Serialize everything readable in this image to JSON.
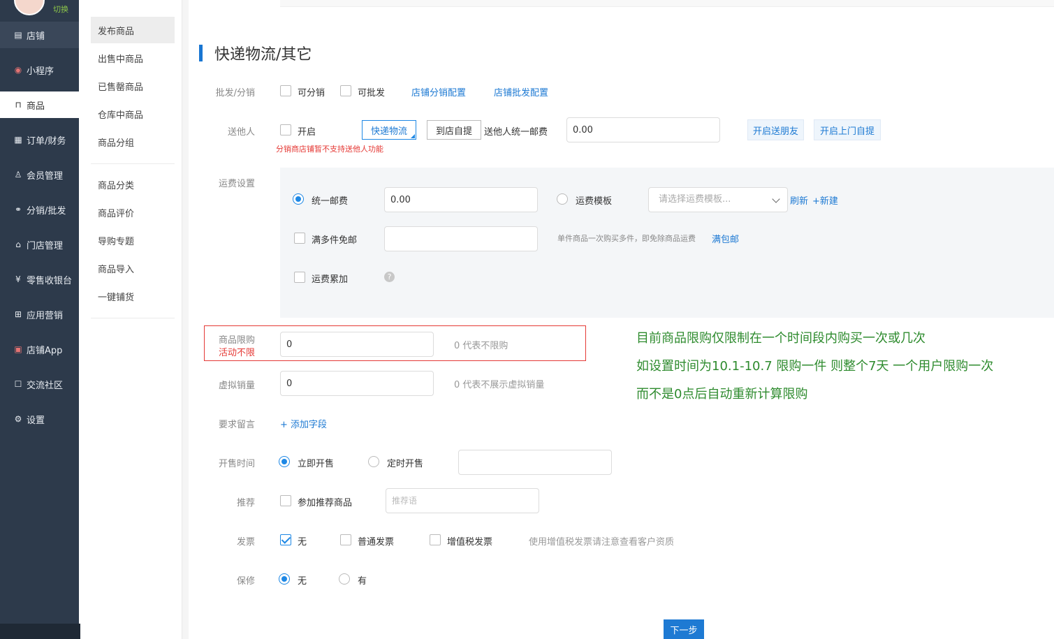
{
  "nav": {
    "switch_label": "切换",
    "items": [
      {
        "label": "店铺",
        "icon": "store-icon"
      },
      {
        "label": "小程序",
        "icon": "miniprogram-icon"
      },
      {
        "label": "商品",
        "icon": "bag-icon"
      },
      {
        "label": "订单/财务",
        "icon": "order-icon"
      },
      {
        "label": "会员管理",
        "icon": "member-icon"
      },
      {
        "label": "分销/批发",
        "icon": "distribution-icon"
      },
      {
        "label": "门店管理",
        "icon": "shop-icon"
      },
      {
        "label": "零售收银台",
        "icon": "cashier-icon"
      },
      {
        "label": "应用营销",
        "icon": "apps-icon"
      },
      {
        "label": "店铺App",
        "icon": "app-icon"
      },
      {
        "label": "交流社区",
        "icon": "community-icon"
      },
      {
        "label": "设置",
        "icon": "gear-icon"
      }
    ],
    "active_index": 2
  },
  "subnav": {
    "group1": [
      "发布商品",
      "出售中商品",
      "已售罄商品",
      "仓库中商品",
      "商品分组"
    ],
    "group2": [
      "商品分类",
      "商品评价",
      "导购专题",
      "商品导入",
      "一键铺货"
    ],
    "active": "发布商品"
  },
  "section": {
    "title": "快递物流/其它"
  },
  "wholesale": {
    "label": "批发/分销",
    "can_distribute": "可分销",
    "can_wholesale": "可批发",
    "link_distribution": "店铺分销配置",
    "link_wholesale": "店铺批发配置"
  },
  "gift": {
    "label": "送他人",
    "enable": "开启",
    "warning": "分销商店铺暂不支持送他人功能",
    "btn_express": "快递物流",
    "btn_pickup": "到店自提",
    "uniform_fee_label": "送他人统一邮费",
    "uniform_fee_value": "0.00",
    "btn_send_friend": "开启送朋友",
    "btn_door_pickup": "开启上门自提"
  },
  "shipping": {
    "label": "运费设置",
    "uniform": "统一邮费",
    "uniform_value": "0.00",
    "template": "运费模板",
    "template_placeholder": "请选择运费模板...",
    "refresh": "刷新",
    "new": "+新建",
    "free_multi": "满多件免邮",
    "free_multi_hint": "单件商品一次购买多件，即免除商品运费",
    "free_link": "满包邮",
    "accumulate": "运费累加",
    "question": "?"
  },
  "limit": {
    "label": "商品限购",
    "sub_label": "活动不限",
    "value": "0",
    "hint": "0 代表不限购"
  },
  "virtual_sales": {
    "label": "虚拟销量",
    "value": "0",
    "hint": "0 代表不展示虚拟销量"
  },
  "message": {
    "label": "要求留言",
    "add": "+ 添加字段"
  },
  "sale_time": {
    "label": "开售时间",
    "immediate": "立即开售",
    "scheduled": "定时开售"
  },
  "recommend": {
    "label": "推荐",
    "option": "参加推荐商品",
    "placeholder": "推荐语"
  },
  "invoice": {
    "label": "发票",
    "none": "无",
    "normal": "普通发票",
    "vat": "增值税发票",
    "hint": "使用增值税发票请注意查看客户资质"
  },
  "warranty": {
    "label": "保修",
    "no": "无",
    "yes": "有"
  },
  "notes": [
    "目前商品限购仅限制在一个时间段内购买一次或几次",
    "如设置时间为10.1-10.7 限购一件  则整个7天  一个用户限购一次",
    "而不是0点后自动重新计算限购"
  ],
  "next_button": "下一步",
  "colors": {
    "nav_bg": "#2d3a4b",
    "accent": "#1e7ad3",
    "warning": "#e53935",
    "note": "#2e8b2e"
  }
}
